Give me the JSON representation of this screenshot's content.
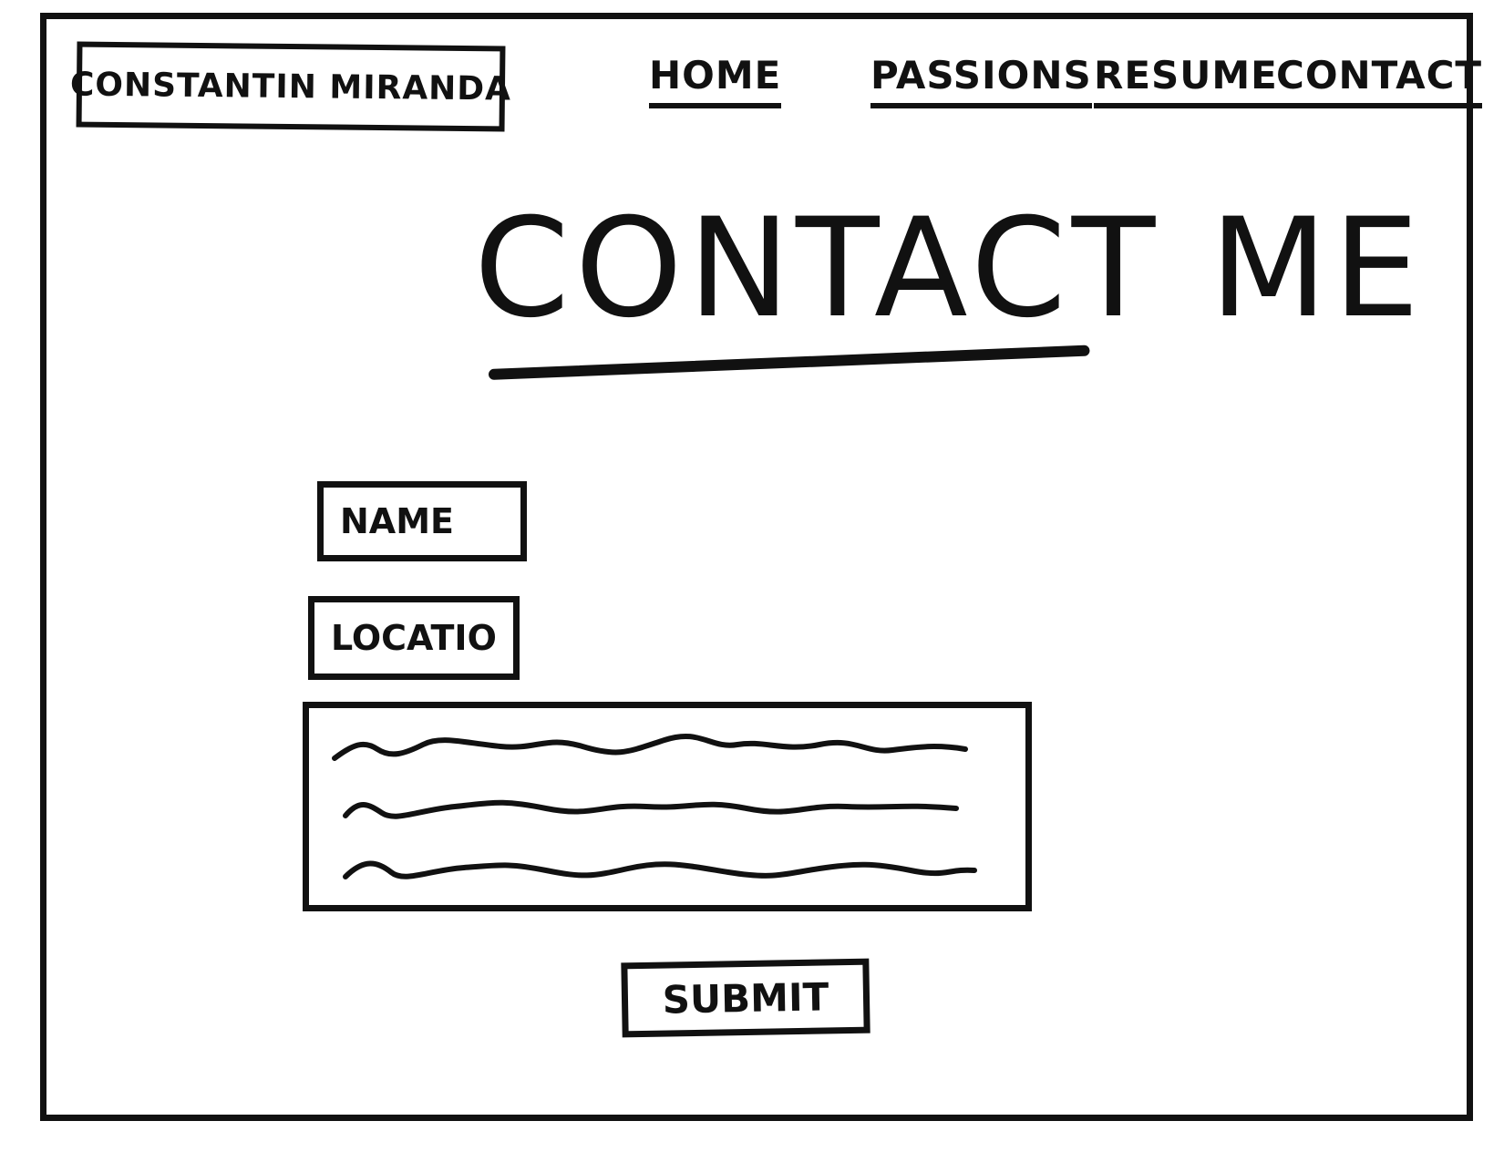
{
  "header": {
    "site_name": "CONSTANTIN MIRANDA",
    "nav": [
      {
        "label": "HOME"
      },
      {
        "label": "PASSIONS"
      },
      {
        "label": "RESUME"
      },
      {
        "label": "CONTACT"
      }
    ]
  },
  "main": {
    "title": "CONTACT ME",
    "form": {
      "name_placeholder": "NAME",
      "location_placeholder": "LOCATION",
      "submit_label": "SUBMIT"
    }
  },
  "colors": {
    "ink": "#111111",
    "paper": "#ffffff"
  }
}
